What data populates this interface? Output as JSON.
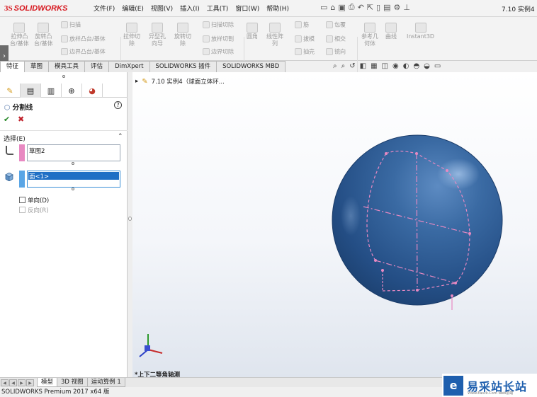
{
  "app": {
    "brand_ds": "3S",
    "brand_name": "SOLIDWORKS"
  },
  "menu": [
    "文件(F)",
    "编辑(E)",
    "视图(V)",
    "插入(I)",
    "工具(T)",
    "窗口(W)",
    "帮助(H)"
  ],
  "document_title": "7.10 实例4 ...",
  "ribbon": {
    "extrude_boss": "拉伸凸\n台/基体",
    "revolve_boss": "旋转凸\n台/基体",
    "sweep": "扫描",
    "loft_boss": "放样凸台/基体",
    "boundary_boss": "边界凸台/基体",
    "extrude_cut": "拉伸切\n除",
    "hole_wizard": "异型孔\n向导",
    "revolve_cut": "旋转切\n除",
    "sweep_cut": "扫描切除",
    "loft_cut": "放样切割",
    "boundary_cut": "边界切除",
    "fillet": "圆角",
    "linear_pattern": "线性阵\n列",
    "rib": "筋",
    "draft": "拔模",
    "shell": "抽壳",
    "wrap": "包覆",
    "intersect": "相交",
    "mirror": "镜向",
    "ref_geometry": "参考几\n何体",
    "curves": "曲线",
    "instant3d": "Instant3D"
  },
  "tabs": [
    {
      "label": "特征",
      "active": true
    },
    {
      "label": "草图",
      "active": false
    },
    {
      "label": "模具工具",
      "active": false
    },
    {
      "label": "评估",
      "active": false
    },
    {
      "label": "DimXpert",
      "active": false
    },
    {
      "label": "SOLIDWORKS 插件",
      "active": false
    },
    {
      "label": "SOLIDWORKS MBD",
      "active": false
    }
  ],
  "property_manager": {
    "title": "分割线",
    "help": "?",
    "ok": "✔",
    "cancel": "✖",
    "selection_group": "选择(E)",
    "collapse": "⌃",
    "sketch_box_item": "草图2",
    "face_box_item": "面<1>",
    "single_direction": "单向(D)",
    "reverse_direction": "反向(R)",
    "sketch_color": "#e889c2",
    "face_color": "#5aa6e6"
  },
  "graphics": {
    "tree_item": "7.10 实例4（球面立体环...",
    "view_caption": "*上下二等角轴测",
    "sphere_color": "#2f5f98",
    "sketch_line_color": "#e889c2"
  },
  "bottom_tabs": [
    {
      "label": "模型",
      "active": true
    },
    {
      "label": "3D 视图",
      "active": false
    },
    {
      "label": "运动算例 1",
      "active": false
    }
  ],
  "status": "SOLIDWORKS Premium 2017 x64 版",
  "watermark": {
    "logo": "e",
    "text": "易采站长站",
    "sub": "Www.Easck.Com Web前端"
  }
}
